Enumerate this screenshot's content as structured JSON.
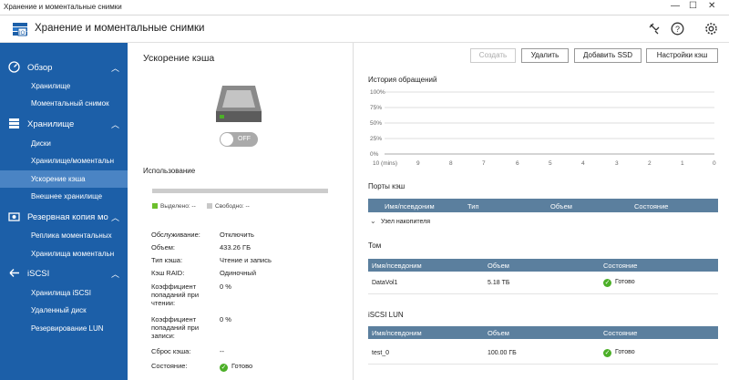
{
  "window": {
    "title": "Хранение и моментальные снимки",
    "min": "—",
    "max": "☐",
    "close": "✕"
  },
  "header": {
    "title": "Хранение и моментальные снимки",
    "icons": [
      "scan-icon",
      "help-icon",
      "settings-icon"
    ]
  },
  "sidebar": {
    "groups": [
      {
        "label": "Обзор",
        "icon": "overview-icon",
        "items": [
          "Хранилище",
          "Моментальный снимок"
        ]
      },
      {
        "label": "Хранилище",
        "icon": "storage-icon",
        "items": [
          "Диски",
          "Хранилище/моментальн",
          "Ускорение кэша",
          "Внешнее хранилище"
        ]
      },
      {
        "label": "Резервная копия мо",
        "icon": "backup-icon",
        "items": [
          "Реплика моментальных",
          "Хранилища моментальн"
        ]
      },
      {
        "label": "iSCSI",
        "icon": "iscsi-icon",
        "items": [
          "Хранилища iSCSI",
          "Удаленный диск",
          "Резервирование LUN"
        ]
      }
    ],
    "active": "Ускорение кэша"
  },
  "cache": {
    "title": "Ускорение кэша",
    "toggle": "OFF",
    "usage_title": "Использование",
    "usage_fraction": 0,
    "legend_used": "Выделено: --",
    "legend_free": "Свободно: --",
    "props": [
      {
        "label": "Обслуживание:",
        "value": "Отключить"
      },
      {
        "label": "Объем:",
        "value": "433.26 ГБ"
      },
      {
        "label": "Тип кэша:",
        "value": "Чтение и запись"
      },
      {
        "label": "Кэш RAID:",
        "value": "Одиночный"
      },
      {
        "label": "Коэффициент попаданий при чтении:",
        "value": "0 %"
      },
      {
        "label": "Коэффициент попаданий при записи:",
        "value": "0 %"
      },
      {
        "label": "Сброс кэша:",
        "value": "--"
      },
      {
        "label": "Состояние:",
        "value": "Готово"
      }
    ]
  },
  "toolbar": {
    "create": "Создать",
    "delete": "Удалить",
    "add_ssd": "Добавить SSD",
    "settings": "Настройки кэш"
  },
  "history": {
    "title": "История обращений",
    "y_ticks": [
      "100%",
      "75%",
      "50%",
      "25%",
      "0%"
    ],
    "x_ticks": [
      "10 (mins)",
      "9",
      "8",
      "7",
      "6",
      "5",
      "4",
      "3",
      "2",
      "1",
      "0"
    ]
  },
  "ports": {
    "title": "Порты кэш",
    "columns": [
      "Имя/псевдоним",
      "Тип",
      "Объем",
      "Состояние"
    ],
    "group_row": "Узел накопителя"
  },
  "volumes": {
    "title": "Том",
    "columns": [
      "Имя/псевдоним",
      "Объем",
      "Состояние"
    ],
    "rows": [
      {
        "name": "DataVol1",
        "size": "5.18 ТБ",
        "status": "Готово"
      }
    ]
  },
  "luns": {
    "title": "iSCSI LUN",
    "columns": [
      "Имя/псевдоним",
      "Объем",
      "Состояние"
    ],
    "rows": [
      {
        "name": "test_0",
        "size": "100.00 ГБ",
        "status": "Готово"
      }
    ]
  },
  "colors": {
    "sidebar": "#1c5fa8",
    "active": "#4a84c4",
    "table_header": "#5b7f9e",
    "ok": "#4caf28",
    "used": "#6cbf2c",
    "free": "#c8c8c8"
  }
}
